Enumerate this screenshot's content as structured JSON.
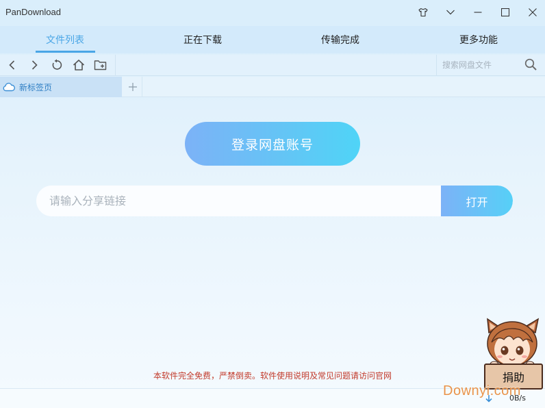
{
  "window": {
    "title": "PanDownload"
  },
  "tabs": [
    {
      "label": "文件列表",
      "active": true
    },
    {
      "label": "正在下载",
      "active": false
    },
    {
      "label": "传输完成",
      "active": false
    },
    {
      "label": "更多功能",
      "active": false
    }
  ],
  "toolbar": {
    "search": {
      "placeholder": "搜索网盘文件"
    }
  },
  "page_tabs": [
    {
      "label": "新标签页",
      "icon": "cloud-icon"
    }
  ],
  "main": {
    "login_label": "登录网盘账号",
    "share_placeholder": "请输入分享链接",
    "open_label": "打开"
  },
  "footer": {
    "notice": "本软件完全免费，严禁倒卖。软件使用说明及常见问题请访问官网",
    "speed": "0B/s",
    "donate_label": "捐助",
    "watermark": "Downyi.com"
  },
  "colors": {
    "accent": "#4aa6e6",
    "notice": "#c23b2b",
    "button_gradient_start": "#7cb2f7",
    "button_gradient_end": "#4fd4f7"
  }
}
